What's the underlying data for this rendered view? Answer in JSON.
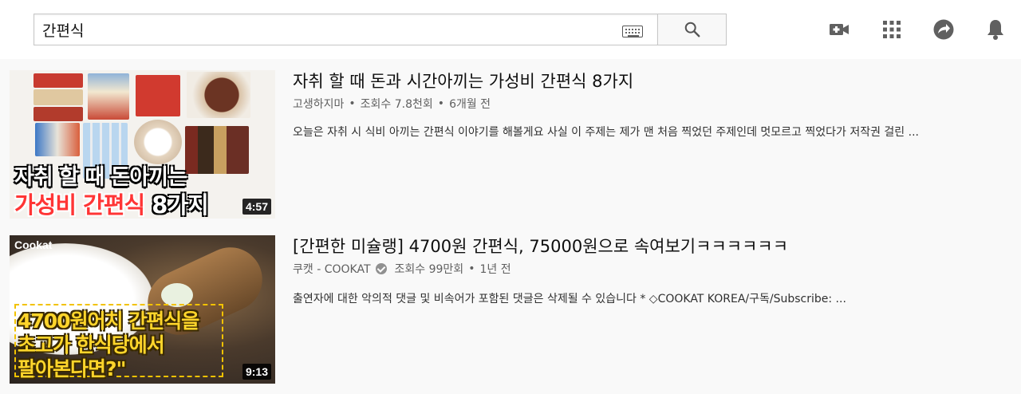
{
  "search": {
    "query": "간편식"
  },
  "results": [
    {
      "title": "자취 할 때 돈과 시간아끼는 가성비 간편식 8가지",
      "channel": "고생하지마",
      "views": "조회수 7.8천회",
      "age": "6개월 전",
      "description": "오늘은 자취 시 식비 아끼는 간편식 이야기를 해볼게요 사실 이 주제는 제가 맨 처음 찍었던 주제인데 멋모르고 찍었다가 저작권 걸린 ...",
      "duration": "4:57",
      "thumb_caption_line1": "자취 할 때 돈아끼는",
      "thumb_caption_line2_red": "가성비 간편식",
      "thumb_caption_line2_white": "8가지"
    },
    {
      "title": "[간편한 미슐랭] 4700원 간편식, 75000원으로 속여보기ㅋㅋㅋㅋㅋㅋ",
      "channel": "쿠캣 - COOKAT",
      "views": "조회수 99만회",
      "age": "1년 전",
      "description": "출연자에 대한 악의적 댓글 및 비속어가 포함된 댓글은 삭제될 수 있습니다 *  ◇COOKAT KOREA/구독/Subscribe: ...",
      "duration": "9:13",
      "thumb_logo": "Cookat",
      "thumb_caption_line1": "4700원어치 간편식을",
      "thumb_caption_line2": "초고가 한식당에서",
      "thumb_caption_line3": "팔아본다면?\""
    }
  ],
  "icons": [
    "keyboard-icon",
    "search-icon",
    "create-video-icon",
    "apps-grid-icon",
    "share-icon",
    "notifications-bell-icon"
  ],
  "colors": {
    "accent_red": "#ff3535",
    "caption_yellow": "#ffd52b",
    "meta_gray": "#606060"
  }
}
